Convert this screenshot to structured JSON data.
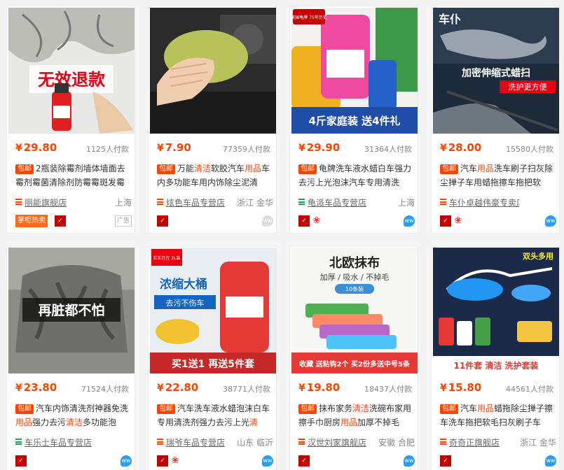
{
  "products": [
    {
      "price": "29.80",
      "currency": "¥",
      "sold": "1125人付款",
      "tag": "包邮",
      "title_parts": [
        {
          "t": "2瓶装除霉剂墙体墙面去霉剂霉菌清除剂防霉霉斑发霉",
          "hl": false
        }
      ],
      "shop": "丽能旗舰店",
      "shop_icon_color": "#ff4400",
      "location": "上海",
      "hot_label": "掌柜热卖",
      "ad_label": "广告",
      "image_text": "无效退款",
      "image_icon": "spray-bottle-icon"
    },
    {
      "price": "7.90",
      "currency": "¥",
      "sold": "77359人付款",
      "tag": "包邮",
      "title_parts": [
        {
          "t": "万能",
          "hl": false
        },
        {
          "t": "清洁",
          "hl": true
        },
        {
          "t": "软胶汽车",
          "hl": false
        },
        {
          "t": "用品",
          "hl": true
        },
        {
          "t": "车内多功能车用内饰除尘泥清",
          "hl": false
        }
      ],
      "shop": "炫色车品专营店",
      "shop_icon_color": "#ff4400",
      "location": "浙江 金华",
      "image_icon": "cleaning-gel-icon"
    },
    {
      "price": "29.90",
      "currency": "¥",
      "sold": "31364人付款",
      "tag": "包邮",
      "title_parts": [
        {
          "t": "龟牌洗车液水蜡白车强力去污上光泡沫汽车专用清洗",
          "hl": false
        }
      ],
      "shop": "龟派车品专营店",
      "shop_icon_color": "#23a55a",
      "location": "上海",
      "image_badge": "美国龟牌 75年历史",
      "image_bottom_text": "4斤家庭装 送4件礼",
      "image_icon": "car-wash-set-icon"
    },
    {
      "price": "28.00",
      "currency": "¥",
      "sold": "15580人付款",
      "tag": "包邮",
      "title_parts": [
        {
          "t": "汽车",
          "hl": false
        },
        {
          "t": "用品",
          "hl": true
        },
        {
          "t": "洗车刷子扫灰除尘掸子车用蜡拖擦车拖把软",
          "hl": false
        }
      ],
      "shop": "车仆卓越伟豪专卖店",
      "shop_icon_color": "#ff4400",
      "location": "",
      "image_brand": "车仆",
      "image_text": "加密伸缩式蜡扫",
      "image_subtext": "洗护更方便",
      "image_icon": "wax-duster-icon"
    },
    {
      "price": "23.80",
      "currency": "¥",
      "sold": "71524人付款",
      "tag": "包邮",
      "title_parts": [
        {
          "t": "汽车内饰清洗剂神器免洗",
          "hl": false
        },
        {
          "t": "用品",
          "hl": true
        },
        {
          "t": "强力去污",
          "hl": false
        },
        {
          "t": "清洁",
          "hl": true
        },
        {
          "t": "多功能泡",
          "hl": false
        }
      ],
      "shop": "车乐士车品专营店",
      "shop_icon_color": "#23a55a",
      "location": "",
      "image_text": "再脏都不怕",
      "image_icon": "car-seat-icon"
    },
    {
      "price": "22.80",
      "currency": "¥",
      "sold": "38771人付款",
      "tag": "包邮",
      "title_parts": [
        {
          "t": "汽车洗车液水蜡泡沫白车专用清洗剂强力去污上光",
          "hl": false
        },
        {
          "t": "清",
          "hl": true
        }
      ],
      "shop": "瑞爷车品专营店",
      "shop_icon_color": "#ff4400",
      "location": "山东 临沂",
      "image_badge": "实实在在 2L装",
      "image_text": "浓缩大桶",
      "image_subtext": "去污不伤车",
      "image_bottom_text": "买1送1 再送5件套",
      "image_icon": "wash-bottle-icon"
    },
    {
      "price": "19.80",
      "currency": "¥",
      "sold": "18437人付款",
      "tag": "包邮",
      "title_parts": [
        {
          "t": "抹布家务",
          "hl": false
        },
        {
          "t": "清洁",
          "hl": true
        },
        {
          "t": "洗碗布家用擦手巾厨房",
          "hl": false
        },
        {
          "t": "用品",
          "hl": true
        },
        {
          "t": "加厚不掉毛",
          "hl": false
        }
      ],
      "shop": "汉世刘家旗舰店",
      "shop_icon_color": "#ff4400",
      "location": "安徽 合肥",
      "image_text": "北欧抹布",
      "image_subtext": "加厚 / 吸水 / 不掉毛",
      "image_badge": "10条装",
      "image_bottom_text": "收藏 送粘钩2个  买2份多送中号5条",
      "image_icon": "towels-icon"
    },
    {
      "price": "15.80",
      "currency": "¥",
      "sold": "44561人付款",
      "tag": "包邮",
      "title_parts": [
        {
          "t": "汽车",
          "hl": false
        },
        {
          "t": "用品",
          "hl": true
        },
        {
          "t": "蜡拖除尘掸子擦车洗车拖把软毛扫灰刷子车",
          "hl": false
        }
      ],
      "shop": "奇奇正旗舰店",
      "shop_icon_color": "#ff4400",
      "location": "浙江 金华",
      "image_text": "双头多用",
      "image_bottom_text": "11件套 清洁 洗护套装",
      "image_icon": "mop-set-icon"
    }
  ]
}
